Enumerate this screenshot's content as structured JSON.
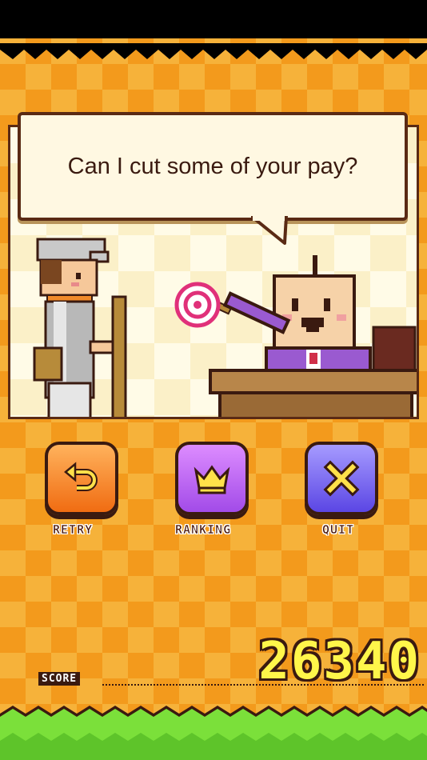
{
  "dialog": {
    "text": "Can I cut some of your pay?"
  },
  "buttons": [
    {
      "label": "RETRY",
      "icon": "retry-arrow-icon"
    },
    {
      "label": "RANKING",
      "icon": "crown-icon"
    },
    {
      "label": "QUIT",
      "icon": "close-x-icon"
    }
  ],
  "score": {
    "label": "SCORE",
    "value": "26340"
  },
  "colors": {
    "background_light": "#f6b23a",
    "background_dark": "#f39a1c",
    "outline": "#3a1a10",
    "score_text": "#fff64a",
    "grass": "#7be03a"
  }
}
